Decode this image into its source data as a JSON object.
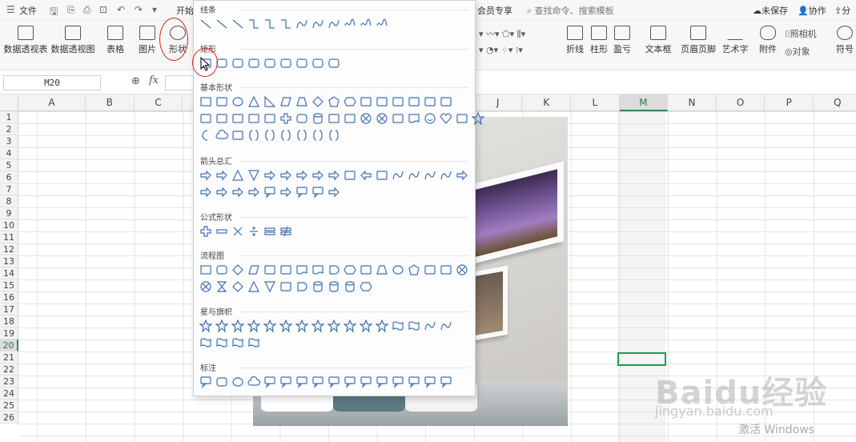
{
  "menubar": {
    "file_label": "文件",
    "start_tab": "开始",
    "member_label": "会员专享",
    "search_placeholder": "查找命令、搜索模板",
    "unsaved": "未保存",
    "collab": "协作",
    "share": "分"
  },
  "ribbon": {
    "pivot_table": "数据透视表",
    "pivot_chart": "数据透视图",
    "table": "表格",
    "picture": "图片",
    "shapes": "形状",
    "line_chart": "折线",
    "column_chart": "柱形",
    "win_loss": "盈亏",
    "textbox": "文本框",
    "header_footer": "页眉页脚",
    "wordart": "艺术字",
    "attachment": "附件",
    "camera": "照相机",
    "object": "对象",
    "symbol": "符号"
  },
  "formula_bar": {
    "name_box": "M20",
    "fx": "fx"
  },
  "columns": [
    "A",
    "B",
    "C",
    "D",
    "E",
    "F",
    "G",
    "H",
    "I",
    "J",
    "K",
    "L",
    "M",
    "N",
    "O",
    "P",
    "Q"
  ],
  "active_column": "M",
  "rows": [
    "1",
    "2",
    "3",
    "4",
    "5",
    "6",
    "7",
    "8",
    "9",
    "10",
    "11",
    "12",
    "13",
    "14",
    "15",
    "16",
    "17",
    "18",
    "19",
    "20",
    "21",
    "22",
    "23",
    "24",
    "25",
    "26"
  ],
  "active_row": "20",
  "shapes_menu": {
    "sections": [
      {
        "title": "线条",
        "rows": [
          [
            "line",
            "line",
            "line",
            "elbow",
            "elbow",
            "elbow",
            "curve",
            "curve",
            "curve",
            "freeform",
            "scribble",
            "scribble"
          ]
        ]
      },
      {
        "title": "矩形",
        "rows": [
          [
            "rect",
            "round-rect",
            "snip1",
            "snip2",
            "snip-round",
            "round1",
            "round2",
            "round-diag",
            "round-rect"
          ]
        ]
      },
      {
        "title": "基本形状",
        "rows": [
          [
            "textbox",
            "vtextbox",
            "ellipse",
            "triangle",
            "rtriangle",
            "parallelogram",
            "trapezoid",
            "diamond",
            "pentagon",
            "hexagon",
            "heptagon",
            "octagon",
            "decagon",
            "dodecagon",
            "pie",
            "chord"
          ],
          [
            "teardrop",
            "frame",
            "halfframe",
            "corner",
            "diagstripe",
            "plus",
            "plaque",
            "can",
            "cube",
            "bevel",
            "donut",
            "nosmoking",
            "blockarc",
            "folded",
            "smiley",
            "heart",
            "lightning",
            "sun"
          ],
          [
            "moon",
            "cloud",
            "arc",
            "bracketpair",
            "bracepair",
            "leftbracket",
            "rightbracket",
            "leftbrace",
            "rightbrace"
          ]
        ]
      },
      {
        "title": "箭头总汇",
        "rows": [
          [
            "right-arrow",
            "left-arrow",
            "up-arrow",
            "down-arrow",
            "leftright-arrow",
            "updown-arrow",
            "quad-arrow",
            "leftrightup",
            "bent-arrow",
            "uturn",
            "leftup",
            "bentup",
            "curved-right",
            "curved-left",
            "curved-up",
            "curved-down",
            "striped-right"
          ],
          [
            "notched-right",
            "pentagon-arrow",
            "chevron",
            "right-callout",
            "down-callout",
            "leftright-callout",
            "up-callout",
            "quad-callout",
            "circular-arrow"
          ]
        ]
      },
      {
        "title": "公式形状",
        "rows": [
          [
            "plus",
            "minus",
            "multiply",
            "divide",
            "equal",
            "notequal"
          ]
        ]
      },
      {
        "title": "流程图",
        "rows": [
          [
            "process",
            "alt-process",
            "decision",
            "data",
            "predefined",
            "internal",
            "document",
            "multidoc",
            "terminator",
            "preparation",
            "manual-input",
            "manual-op",
            "connector",
            "offpage",
            "card",
            "punched-tape",
            "summing"
          ],
          [
            "or",
            "collate",
            "sort",
            "extract",
            "merge",
            "stored-data",
            "delay",
            "seq-storage",
            "magnetic-disk",
            "direct-storage",
            "display"
          ]
        ]
      },
      {
        "title": "星与旗帜",
        "rows": [
          [
            "explosion1",
            "explosion2",
            "star4",
            "star5",
            "star6",
            "star7",
            "star8",
            "star10",
            "star12",
            "star16",
            "star24",
            "star32",
            "ribbon-up",
            "ribbon-down",
            "curved-up-ribbon",
            "curved-down-ribbon"
          ],
          [
            "vscroll",
            "hscroll",
            "wave",
            "doublewave"
          ]
        ]
      },
      {
        "title": "标注",
        "rows": [
          [
            "rect-callout",
            "round-callout",
            "oval-callout",
            "cloud-callout",
            "line-callout1",
            "line-callout2",
            "line-callout3",
            "accent1",
            "accent2",
            "accent3",
            "border1",
            "border2",
            "border3",
            "accent-border1",
            "accent-border2",
            "accent-border3"
          ]
        ]
      }
    ]
  },
  "watermark": {
    "baidu": "Baidu经验",
    "url": "jingyan.baidu.com",
    "activate": "激活 Windows"
  }
}
